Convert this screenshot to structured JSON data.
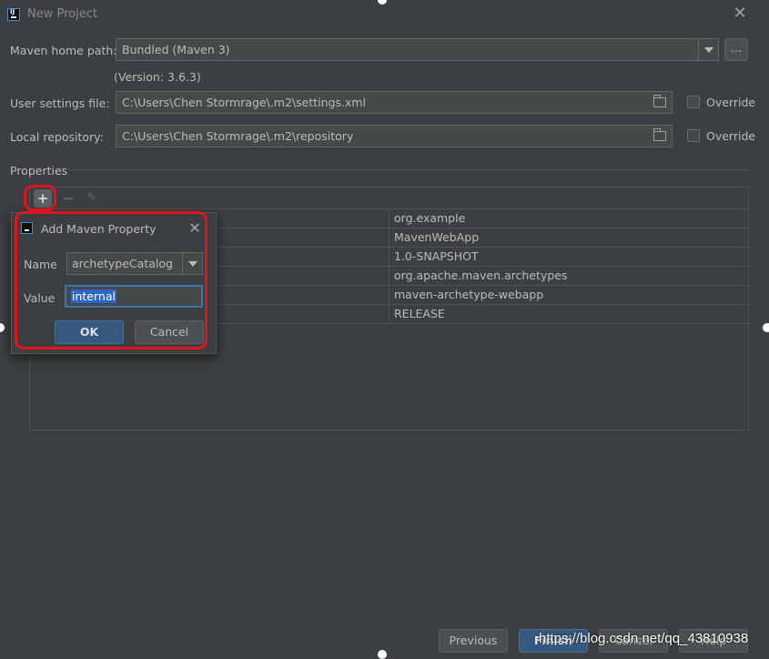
{
  "window": {
    "title": "New Project"
  },
  "maven_home": {
    "label": "Maven home path:",
    "value": "Bundled (Maven 3)",
    "browse_label": "...",
    "version": "(Version: 3.6.3)"
  },
  "user_settings": {
    "label": "User settings file:",
    "value": "C:\\Users\\Chen Stormrage\\.m2\\settings.xml",
    "override_label": "Override"
  },
  "local_repo": {
    "label": "Local repository:",
    "value": "C:\\Users\\Chen Stormrage\\.m2\\repository",
    "override_label": "Override"
  },
  "properties": {
    "heading": "Properties",
    "toolbar": {
      "add": "+",
      "remove": "−",
      "edit": "✎"
    },
    "values": [
      "org.example",
      "MavenWebApp",
      "1.0-SNAPSHOT",
      "org.apache.maven.archetypes",
      "maven-archetype-webapp",
      "RELEASE"
    ]
  },
  "dialog": {
    "title": "Add Maven Property",
    "close": "✕",
    "name_label": "Name",
    "name_value": "archetypeCatalog",
    "value_label": "Value",
    "value_value": "internal",
    "ok": "OK",
    "cancel": "Cancel"
  },
  "footer": {
    "previous": "Previous",
    "finish": "Finish",
    "cancel": "Cancel",
    "help": "Help"
  },
  "watermark": "https://blog.csdn.net/qq_43810938",
  "colors": {
    "background": "#3c3f41",
    "field": "#45494a",
    "accent": "#365880",
    "highlight": "#e0141e"
  }
}
